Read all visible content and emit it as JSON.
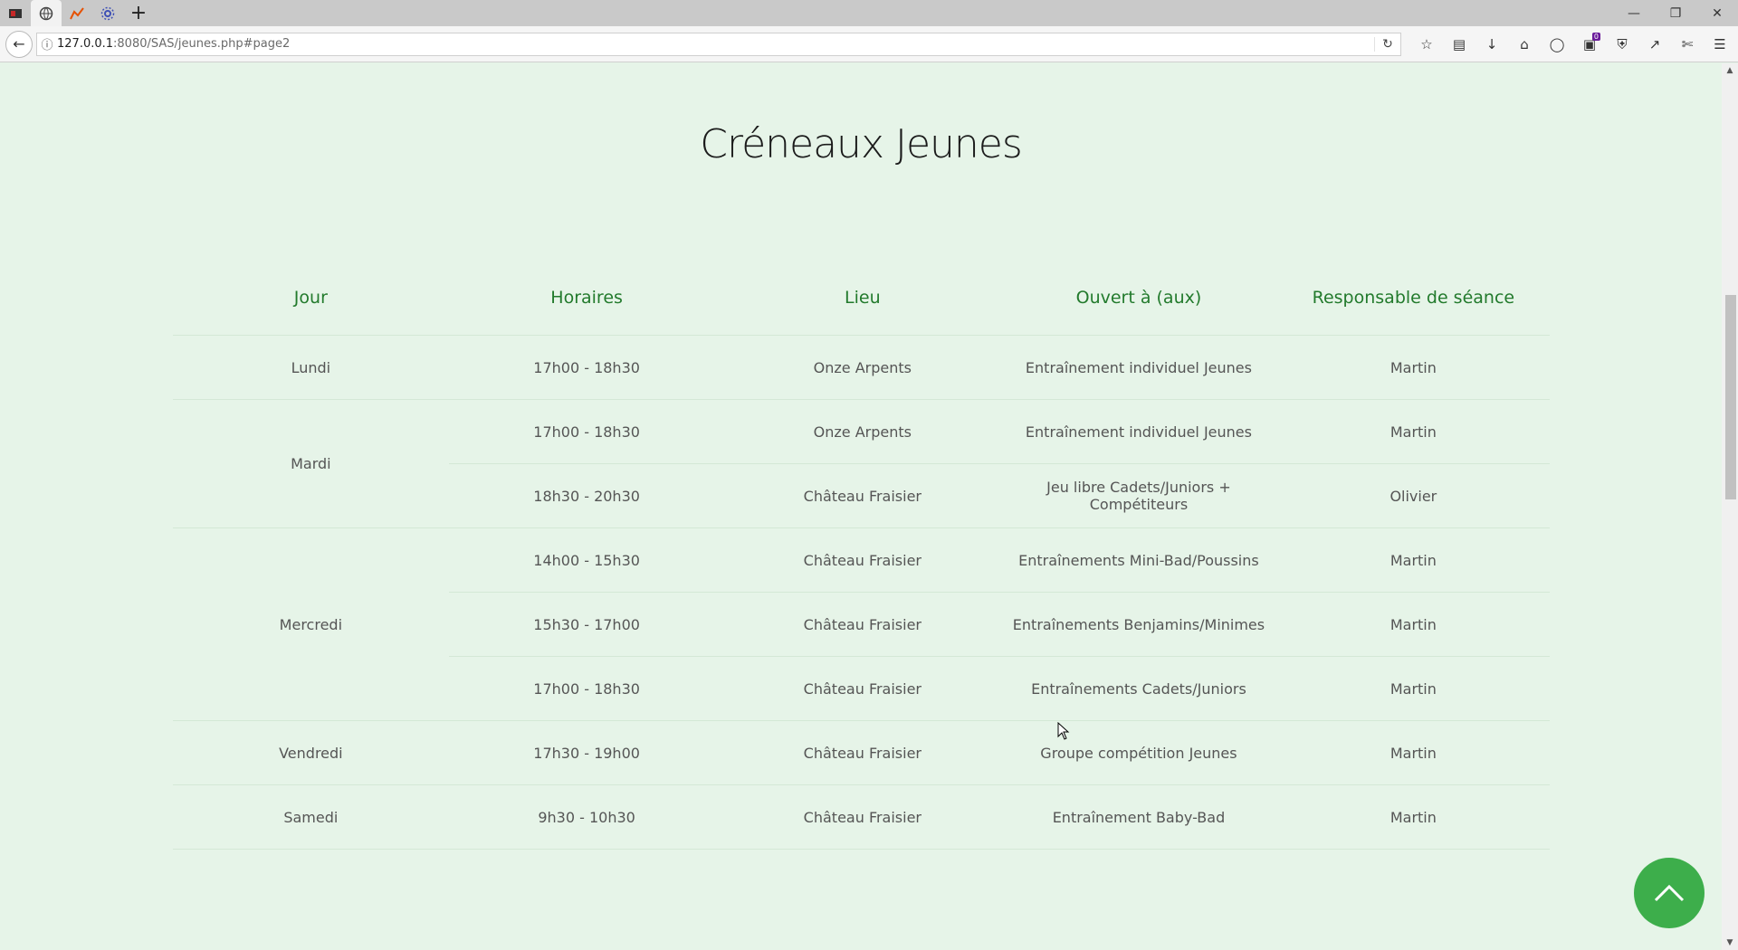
{
  "browser": {
    "tabs": [
      {
        "icon": "media-icon"
      },
      {
        "icon": "globe-icon"
      },
      {
        "icon": "chart-icon"
      },
      {
        "icon": "settings-icon"
      }
    ],
    "new_tab_label": "+",
    "url_host": "127.0.0.1",
    "url_path": ":8080/SAS/jeunes.php#page2",
    "notification_count": "0"
  },
  "page": {
    "title": "Créneaux Jeunes"
  },
  "table": {
    "headers": [
      "Jour",
      "Horaires",
      "Lieu",
      "Ouvert à (aux)",
      "Responsable de séance"
    ],
    "rows": [
      {
        "day": "Lundi",
        "time": "17h00 - 18h30",
        "place": "Onze Arpents",
        "open_to": "Entraînement individuel Jeunes",
        "manager": "Martin"
      },
      {
        "day": "Mardi",
        "time": "17h00 - 18h30",
        "place": "Onze Arpents",
        "open_to": "Entraînement individuel Jeunes",
        "manager": "Martin"
      },
      {
        "time": "18h30 - 20h30",
        "place": "Château Fraisier",
        "open_to": "Jeu libre Cadets/Juniors + Compétiteurs",
        "manager": "Olivier"
      },
      {
        "day": "Mercredi",
        "time": "14h00 - 15h30",
        "place": "Château Fraisier",
        "open_to": "Entraînements Mini-Bad/Poussins",
        "manager": "Martin"
      },
      {
        "time": "15h30 - 17h00",
        "place": "Château Fraisier",
        "open_to": "Entraînements Benjamins/Minimes",
        "manager": "Martin"
      },
      {
        "time": "17h00 - 18h30",
        "place": "Château Fraisier",
        "open_to": "Entraînements Cadets/Juniors",
        "manager": "Martin"
      },
      {
        "day": "Vendredi",
        "time": "17h30 - 19h00",
        "place": "Château Fraisier",
        "open_to": "Groupe compétition Jeunes",
        "manager": "Martin"
      },
      {
        "day": "Samedi",
        "time": "9h30 - 10h30",
        "place": "Château Fraisier",
        "open_to": "Entraînement Baby-Bad",
        "manager": "Martin"
      }
    ]
  },
  "colors": {
    "page_background": "#e6f4e8",
    "header_text": "#227a2c",
    "back_to_top": "#3dae4b"
  }
}
